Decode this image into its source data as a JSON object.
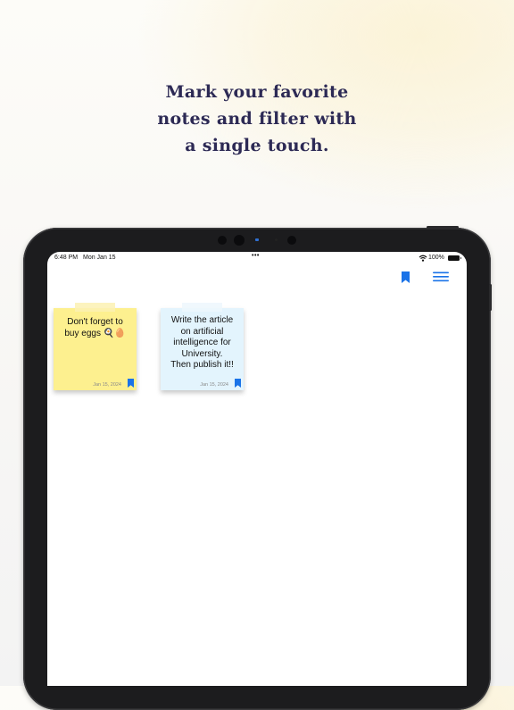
{
  "headline": {
    "lines": [
      "Mark your favorite",
      "notes and filter with",
      "a single touch."
    ]
  },
  "status_bar": {
    "time": "6:48 PM",
    "date": "Mon Jan 15",
    "battery": "100%",
    "icons": [
      "wifi-icon",
      "battery-icon",
      "multitask-dots-icon"
    ]
  },
  "toolbar": {
    "icons": [
      "bookmark-filter-icon",
      "menu-icon"
    ],
    "accent_color": "#1a73e8"
  },
  "notes": [
    {
      "lines": [
        "Don't forget to",
        "buy eggs 🍳🥚"
      ],
      "date": "Jan 15, 2024",
      "color": "#fdf08f",
      "tape_color": "#fbf1b3",
      "bookmarked": true
    },
    {
      "lines": [
        "Write the article",
        "on artificial",
        "intelligence for",
        "University.",
        "Then publish it!!"
      ],
      "date": "Jan 15, 2024",
      "color": "#e3f4fd",
      "tape_color": "#edf7fd",
      "bookmarked": true
    }
  ]
}
